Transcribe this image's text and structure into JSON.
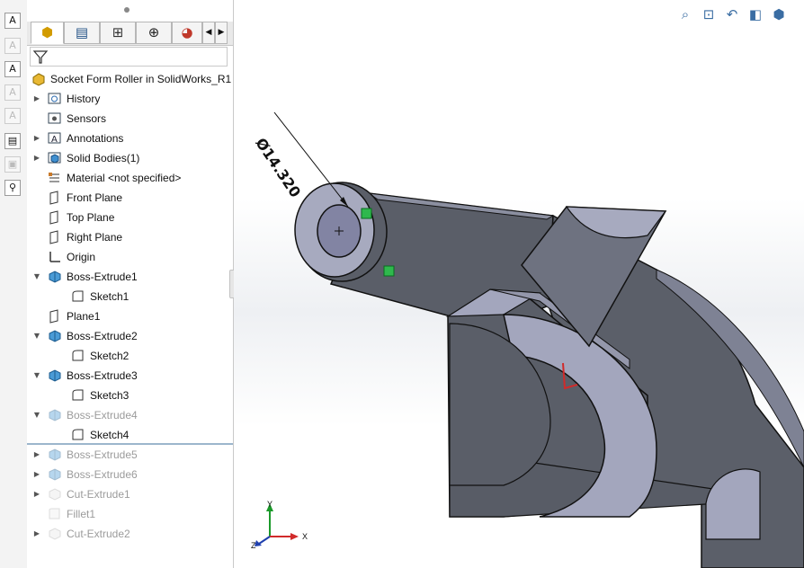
{
  "left_toolbar": {
    "icons": [
      "smart-dimension-icon",
      "note-icon",
      "auto-balloon-icon",
      "balloon-icon",
      "magnetic-line-icon",
      "table-icon",
      "block-icon",
      "hole-callout-icon"
    ]
  },
  "tabs": [
    "FeatureManager design tree",
    "PropertyManager",
    "ConfigurationManager",
    "DimXpertManager",
    "DisplayManager"
  ],
  "tree": {
    "root": "Socket Form Roller in SolidWorks_R1",
    "items": [
      {
        "label": "History",
        "icon": "history-folder-icon",
        "arrow": "right",
        "indent": 0
      },
      {
        "label": "Sensors",
        "icon": "sensors-icon",
        "arrow": "",
        "indent": 0
      },
      {
        "label": "Annotations",
        "icon": "annotations-icon",
        "arrow": "right",
        "indent": 0
      },
      {
        "label": "Solid Bodies(1)",
        "icon": "solid-bodies-icon",
        "arrow": "right",
        "indent": 0
      },
      {
        "label": "Material <not specified>",
        "icon": "material-icon",
        "arrow": "",
        "indent": 0
      },
      {
        "label": "Front Plane",
        "icon": "plane-icon",
        "arrow": "",
        "indent": 0
      },
      {
        "label": "Top Plane",
        "icon": "plane-icon",
        "arrow": "",
        "indent": 0
      },
      {
        "label": "Right Plane",
        "icon": "plane-icon",
        "arrow": "",
        "indent": 0
      },
      {
        "label": "Origin",
        "icon": "origin-icon",
        "arrow": "",
        "indent": 0
      },
      {
        "label": "Boss-Extrude1",
        "icon": "extrude-icon",
        "arrow": "down",
        "indent": 0
      },
      {
        "label": "Sketch1",
        "icon": "sketch-icon",
        "arrow": "",
        "indent": 1
      },
      {
        "label": "Plane1",
        "icon": "plane-icon",
        "arrow": "",
        "indent": 0
      },
      {
        "label": "Boss-Extrude2",
        "icon": "extrude-icon",
        "arrow": "down",
        "indent": 0
      },
      {
        "label": "Sketch2",
        "icon": "sketch-icon",
        "arrow": "",
        "indent": 1
      },
      {
        "label": "Boss-Extrude3",
        "icon": "extrude-icon",
        "arrow": "down",
        "indent": 0
      },
      {
        "label": "Sketch3",
        "icon": "sketch-icon",
        "arrow": "",
        "indent": 1
      },
      {
        "label": "Boss-Extrude4",
        "icon": "extrude-icon",
        "arrow": "down",
        "indent": 0,
        "suppressed": true
      },
      {
        "label": "Sketch4",
        "icon": "sketch-icon",
        "arrow": "",
        "indent": 1
      },
      {
        "label": "Boss-Extrude5",
        "icon": "extrude-icon",
        "arrow": "right",
        "indent": 0,
        "suppressed": true
      },
      {
        "label": "Boss-Extrude6",
        "icon": "extrude-icon",
        "arrow": "right",
        "indent": 0,
        "suppressed": true
      },
      {
        "label": "Cut-Extrude1",
        "icon": "cut-extrude-icon",
        "arrow": "right",
        "indent": 0,
        "suppressed": true
      },
      {
        "label": "Fillet1",
        "icon": "fillet-icon",
        "arrow": "",
        "indent": 0,
        "suppressed": true
      },
      {
        "label": "Cut-Extrude2",
        "icon": "cut-extrude-icon",
        "arrow": "right",
        "indent": 0,
        "suppressed": true
      }
    ]
  },
  "viewport": {
    "dimension": "Ø14.320",
    "triad": {
      "x": "X",
      "y": "Y",
      "z": "Z"
    },
    "toolbar_icons": [
      "zoom-to-fit-icon",
      "zoom-to-area-icon",
      "previous-view-icon",
      "section-view-icon",
      "view-orientation-icon"
    ]
  },
  "colors": {
    "model_face": "#5a5e68",
    "model_light": "#a3a6bd",
    "model_edge": "#111111",
    "accent_blue": "#3a6da3"
  }
}
